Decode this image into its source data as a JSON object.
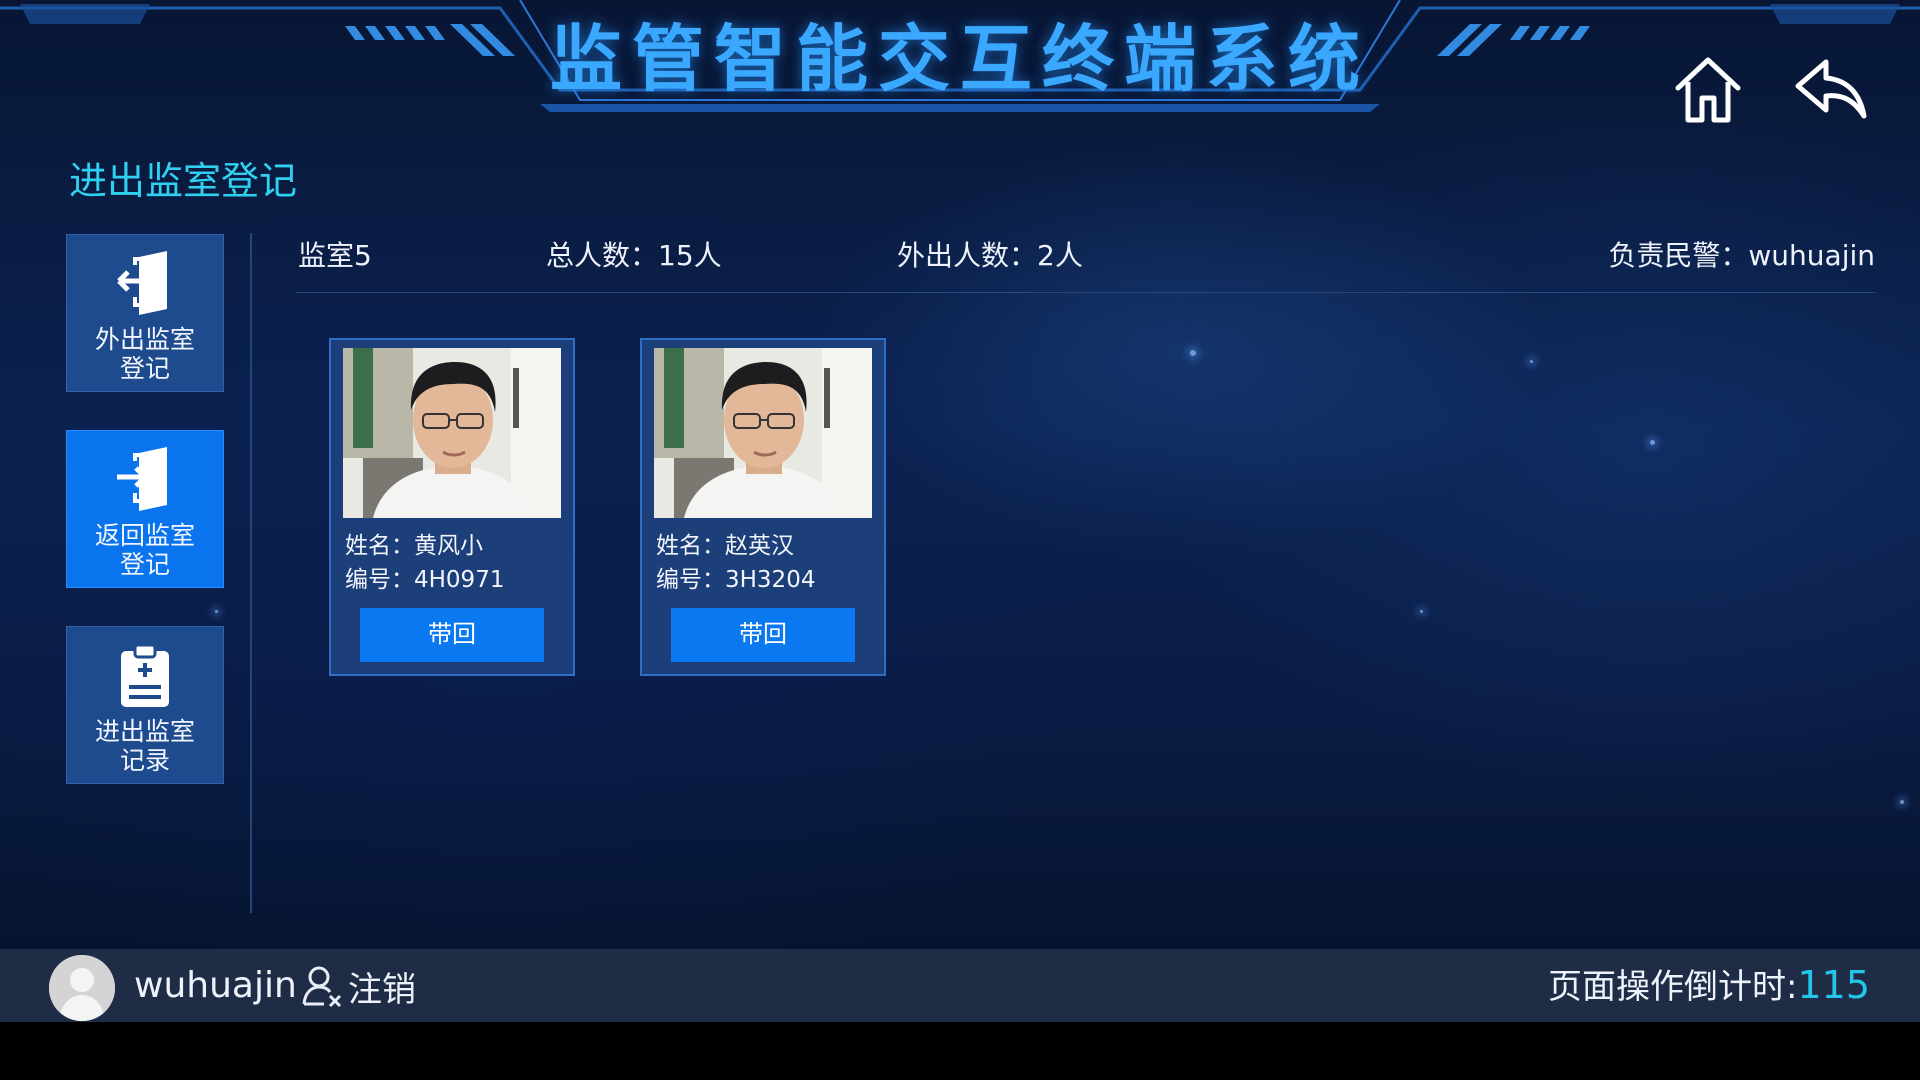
{
  "header": {
    "title": "监管智能交互终端系统"
  },
  "page": {
    "title": "进出监室登记"
  },
  "sidebar": {
    "items": [
      {
        "label": "外出监室登记",
        "icon": "exit-door-icon",
        "active": false
      },
      {
        "label": "返回监室登记",
        "icon": "enter-door-icon",
        "active": true
      },
      {
        "label": "进出监室记录",
        "icon": "clipboard-icon",
        "active": false
      }
    ]
  },
  "info": {
    "room": "监室5",
    "total_label": "总人数：",
    "total_value": "15人",
    "out_label": "外出人数：",
    "out_value": "2人",
    "officer_label": "负责民警：",
    "officer_value": "wuhuajin"
  },
  "cards": [
    {
      "name_label": "姓名：",
      "name": "黄风小",
      "id_label": "编号：",
      "id": "4H0971",
      "button": "带回"
    },
    {
      "name_label": "姓名：",
      "name": "赵英汉",
      "id_label": "编号：",
      "id": "3H3204",
      "button": "带回"
    }
  ],
  "footer": {
    "username": "wuhuajin",
    "logout_label": "注销",
    "countdown_label": "页面操作倒计时:",
    "countdown_value": "115"
  },
  "colors": {
    "accent": "#0a78f0",
    "title": "#3aa8ff",
    "countdown": "#22c6ea"
  }
}
